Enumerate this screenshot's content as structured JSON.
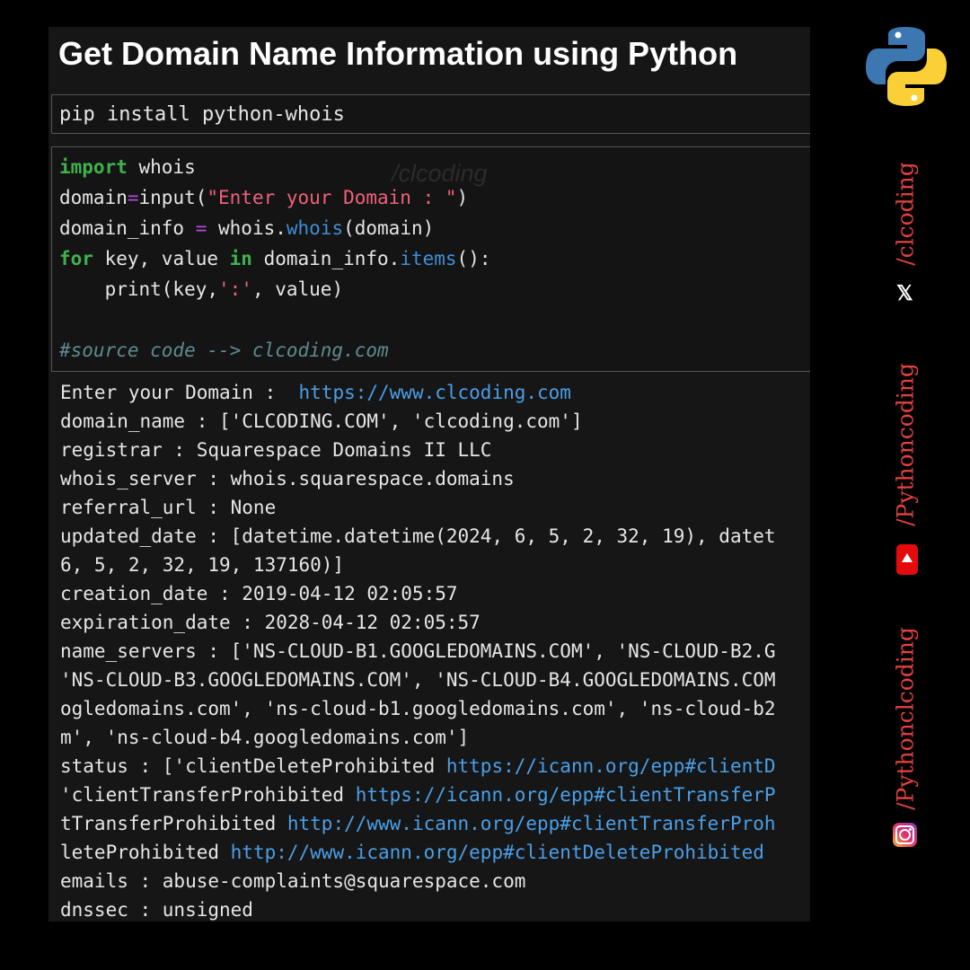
{
  "title": "Get Domain Name Information using Python",
  "install_cmd": "pip install python-whois",
  "watermark": "/clcoding",
  "code": {
    "l1_kw": "import",
    "l1_rest": " whois",
    "l2_a": "domain",
    "l2_op": "=",
    "l2_b": "input(",
    "l2_str": "\"Enter your Domain : \"",
    "l2_c": ")",
    "l3_a": "domain_info ",
    "l3_op": "=",
    "l3_b": " whois.",
    "l3_fn": "whois",
    "l3_c": "(domain)",
    "l4_kw1": "for",
    "l4_a": " key, value ",
    "l4_kw2": "in",
    "l4_b": " domain_info.",
    "l4_fn": "items",
    "l4_c": "():",
    "l5_a": "    print(key,",
    "l5_str": "':'",
    "l5_b": ", value)",
    "comment": "#source code --> clcoding.com"
  },
  "output": {
    "o1_a": "Enter your Domain :  ",
    "o1_link": "https://www.clcoding.com",
    "o2": "domain_name : ['CLCODING.COM', 'clcoding.com']",
    "o3": "registrar : Squarespace Domains II LLC",
    "o4": "whois_server : whois.squarespace.domains",
    "o5": "referral_url : None",
    "o6": "updated_date : [datetime.datetime(2024, 6, 5, 2, 32, 19), datet",
    "o7": "6, 5, 2, 32, 19, 137160)]",
    "o8": "creation_date : 2019-04-12 02:05:57",
    "o9": "expiration_date : 2028-04-12 02:05:57",
    "o10": "name_servers : ['NS-CLOUD-B1.GOOGLEDOMAINS.COM', 'NS-CLOUD-B2.G",
    "o11": "'NS-CLOUD-B3.GOOGLEDOMAINS.COM', 'NS-CLOUD-B4.GOOGLEDOMAINS.COM",
    "o12": "ogledomains.com', 'ns-cloud-b1.googledomains.com', 'ns-cloud-b2",
    "o13": "m', 'ns-cloud-b4.googledomains.com']",
    "o14_a": "status : ['clientDeleteProhibited ",
    "o14_link": "https://icann.org/epp#clientD",
    "o15_a": "'clientTransferProhibited ",
    "o15_link": "https://icann.org/epp#clientTransferP",
    "o16_a": "tTransferProhibited ",
    "o16_link": "http://www.icann.org/epp#clientTransferProh",
    "o17_a": "leteProhibited ",
    "o17_link": "http://www.icann.org/epp#clientDeleteProhibited",
    "o18": "emails : abuse-complaints@squarespace.com",
    "o19": "dnssec : unsigned"
  },
  "sidebar": {
    "handle_1": "/clcoding",
    "handle_2": "/Pythoncoding",
    "handle_3": "/Pythonclcoding",
    "x_icon": "𝕏"
  },
  "colors": {
    "keyword": "#3fb14e",
    "operator": "#b34ddb",
    "string": "#f0607b",
    "function": "#3e8fd8",
    "comment": "#5f8b8f",
    "link": "#4a9fe8",
    "handle": "#e54141"
  }
}
